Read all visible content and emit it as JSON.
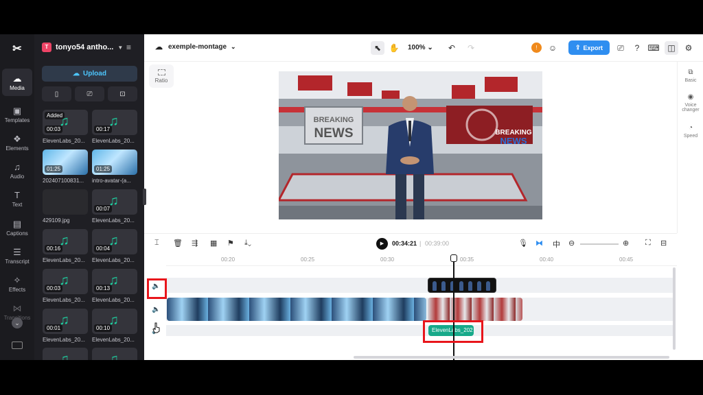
{
  "app": {
    "logo": "capcut-logo",
    "accent": "#2f8ef0"
  },
  "nav": {
    "items": [
      {
        "label": "Media",
        "icon": "cloud-icon"
      },
      {
        "label": "Templates",
        "icon": "templates-icon"
      },
      {
        "label": "Elements",
        "icon": "elements-icon"
      },
      {
        "label": "Audio",
        "icon": "music-icon"
      },
      {
        "label": "Text",
        "icon": "text-icon"
      },
      {
        "label": "Captions",
        "icon": "captions-icon"
      },
      {
        "label": "Transcript",
        "icon": "transcript-icon"
      },
      {
        "label": "Effects",
        "icon": "effects-icon"
      },
      {
        "label": "Transitions",
        "icon": "transitions-icon"
      }
    ]
  },
  "panel": {
    "account_initial": "T",
    "account_name": "tonyo54 antho...",
    "upload_label": "Upload",
    "media": [
      {
        "name": "ElevenLabs_20...",
        "duration": "00:03",
        "added": "Added",
        "kind": "audio"
      },
      {
        "name": "ElevenLabs_20...",
        "duration": "00:17",
        "kind": "audio"
      },
      {
        "name": "202407100831...",
        "duration": "01:25",
        "kind": "studio"
      },
      {
        "name": "intro-avatar-(a...",
        "duration": "01:25",
        "kind": "studio"
      },
      {
        "name": "429109.jpg",
        "duration": "",
        "kind": "dark"
      },
      {
        "name": "ElevenLabs_20...",
        "duration": "00:07",
        "kind": "audio"
      },
      {
        "name": "ElevenLabs_20...",
        "duration": "00:16",
        "kind": "audio"
      },
      {
        "name": "ElevenLabs_20...",
        "duration": "00:04",
        "kind": "audio"
      },
      {
        "name": "ElevenLabs_20...",
        "duration": "00:03",
        "kind": "audio"
      },
      {
        "name": "ElevenLabs_20...",
        "duration": "00:13",
        "kind": "audio"
      },
      {
        "name": "ElevenLabs_20...",
        "duration": "00:01",
        "kind": "audio"
      },
      {
        "name": "ElevenLabs_20...",
        "duration": "00:10",
        "kind": "audio"
      },
      {
        "name": "",
        "duration": "",
        "kind": "audio"
      },
      {
        "name": "",
        "duration": "",
        "kind": "audio"
      }
    ]
  },
  "topbar": {
    "project_name": "exemple-montage",
    "zoom": "100%",
    "user_initial": "!",
    "export_label": "Export"
  },
  "preview": {
    "ratio_label": "Ratio",
    "sign_left": [
      "BREAKING",
      "NEWS"
    ],
    "sign_right": [
      "BREAKING",
      "NEWS"
    ]
  },
  "right_rail": {
    "basic": "Basic",
    "voice_changer": "Voice changer",
    "speed": "Speed"
  },
  "timeline": {
    "current_time": "00:34:21",
    "separator": "|",
    "total_time": "00:39:00",
    "ticks": [
      "00:20",
      "00:25",
      "00:30",
      "00:35",
      "00:40",
      "00:45"
    ],
    "audio_clip_label": "ElevenLabs_202"
  }
}
